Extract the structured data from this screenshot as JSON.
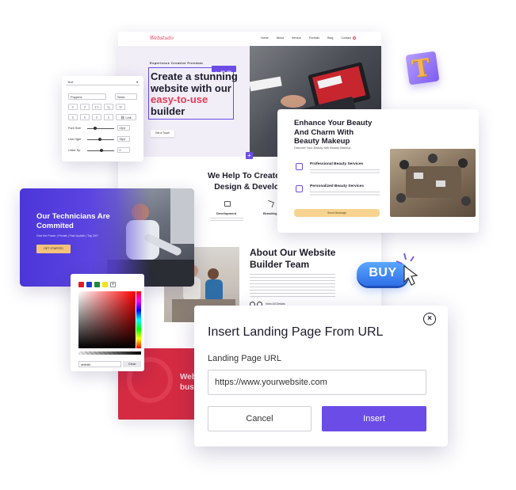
{
  "site": {
    "logo": "Webstudo",
    "nav": [
      "Home",
      "About",
      "Service",
      "Portfolio",
      "Blog",
      "Contact"
    ],
    "tagline": "Experience Creative Freedom",
    "hero_title_1": "Create a stunning",
    "hero_title_2": "website with our",
    "hero_title_red": "easy-to-use",
    "hero_title_3": "builder",
    "hero_button": "Get a Touch",
    "help_title_1": "We Help To Create Stra",
    "help_title_2": "Design & Developm",
    "feature_1": "Development",
    "feature_2": "Branding",
    "about_title_1": "About Our Website",
    "about_title_2": "Builder Team",
    "about_link": "View All Details",
    "footer_text_1": "Web",
    "footer_text_2": "busi"
  },
  "text_panel": {
    "title": "Text",
    "font_family": "Poppins",
    "font_weight": "Semi-",
    "style_buttons": [
      "T",
      "T",
      "TT",
      "T₂",
      "T²"
    ],
    "align_buttons": [
      "≡",
      "≡",
      "≡",
      "≡"
    ],
    "link_label": "Link",
    "font_size_label": "Font Size",
    "font_size_value": "22px",
    "line_height_label": "Line Hght",
    "line_height_value": "26px",
    "letter_spacing_label": "Letter Sp",
    "letter_spacing_value": "0"
  },
  "tech": {
    "title_1": "Our Technicians Are",
    "title_2": "Commited",
    "subtitle": "Give the Power | Private | Fast Update | Top 24/7",
    "button": "GET STARTED"
  },
  "beauty": {
    "title_1": "Enhance Your Beauty",
    "title_2": "And Charm With",
    "title_3": "Beauty Makeup",
    "subtitle": "Discover Your Beauty with Beauty Makeup",
    "item_1": "Professional Beauty Services",
    "item_2": "Personalized Beauty Services",
    "button": "Send Message"
  },
  "color_picker": {
    "swatches": [
      "#e11b22",
      "#1d3bd1",
      "#1f8a3a",
      "#f2e21a"
    ],
    "hex_value": "#bfbfbf",
    "clear_label": "Clear"
  },
  "dialog": {
    "title": "Insert Landing Page From URL",
    "field_label": "Landing Page URL",
    "url_value": "https://www.yourwebsite.com",
    "cancel_label": "Cancel",
    "insert_label": "Insert"
  },
  "floaters": {
    "t_block_letter": "T",
    "buy_label": "BUY"
  },
  "colors": {
    "accent": "#6b4ce6",
    "brand_red": "#e33b54",
    "gold": "#f6d38f"
  }
}
